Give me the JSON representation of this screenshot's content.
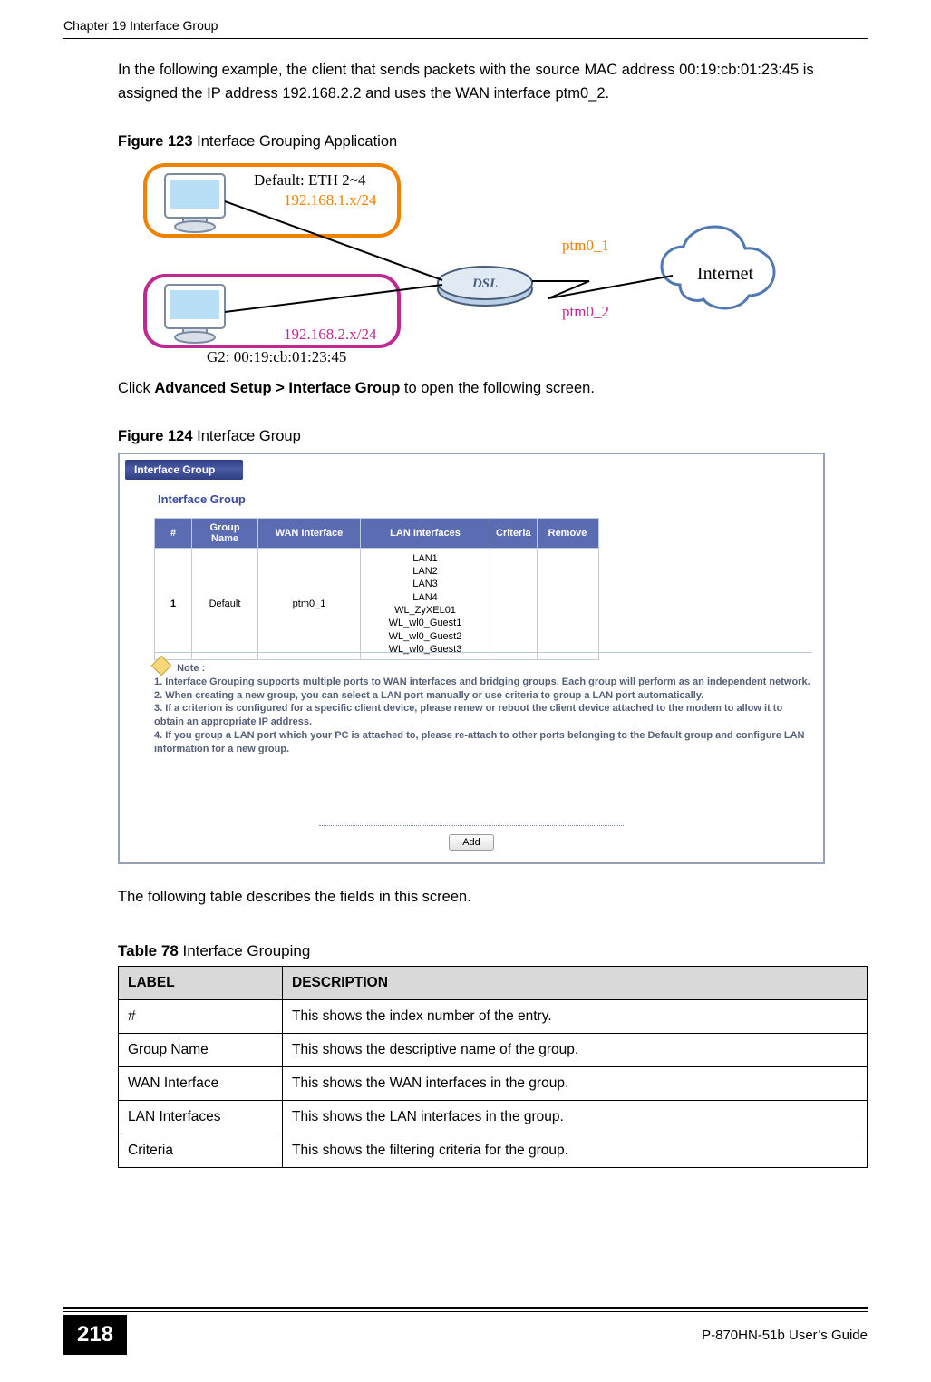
{
  "header": {
    "chapter_title": "Chapter 19 Interface Group"
  },
  "content": {
    "intro_para": "In the following example, the client that sends packets with the source MAC address 00:19:cb:01:23:45 is assigned the IP address 192.168.2.2 and uses the WAN interface ptm0_2.",
    "figure123_num": "Figure 123",
    "figure123_title": "   Interface Grouping Application",
    "diagram": {
      "default_label": "Default: ETH 2~4",
      "default_subnet": "192.168.1.x/24",
      "g2_subnet": "192.168.2.x/24",
      "g2_label": "G2: 00:19:cb:01:23:45",
      "ptm1": "ptm0_1",
      "ptm2": "ptm0_2",
      "internet": "Internet"
    },
    "click_para_prefix": "Click ",
    "click_para_bold": "Advanced Setup > Interface Group",
    "click_para_suffix": " to open the following screen.",
    "figure124_num": "Figure 124",
    "figure124_title": "   Interface Group",
    "screenshot": {
      "bar_title": "Interface Group",
      "section_title": "Interface Group",
      "headers": {
        "num": "#",
        "group": "Group Name",
        "wan": "WAN Interface",
        "lan": "LAN Interfaces",
        "criteria": "Criteria",
        "remove": "Remove"
      },
      "row": {
        "num": "1",
        "group": "Default",
        "wan": "ptm0_1",
        "lan": [
          "LAN1",
          "LAN2",
          "LAN3",
          "LAN4",
          "WL_ZyXEL01",
          "WL_wl0_Guest1",
          "WL_wl0_Guest2",
          "WL_wl0_Guest3"
        ],
        "criteria": "",
        "remove": ""
      },
      "note_label": "Note :",
      "note1": "1. Interface Grouping supports multiple ports to WAN interfaces and bridging groups. Each group will perform as an independent network.",
      "note2": "2. When creating a new group, you can select a LAN port manually or use criteria to group a LAN port automatically.",
      "note3": "3. If a criterion is configured for a specific client device, please renew or reboot the client device attached to the modem to allow it to obtain an appropriate IP address.",
      "note4": "4. If you group a LAN port which your PC is attached to, please re-attach to other ports belonging to the Default group and configure LAN information for a new group.",
      "add_btn": "Add"
    },
    "table_intro": "The following table describes the fields in this screen.",
    "table78_num": "Table 78",
    "table78_title": "   Interface Grouping",
    "desc_table": {
      "header_label": "LABEL",
      "header_desc": "DESCRIPTION",
      "rows": [
        {
          "label": "#",
          "desc": "This shows the index number of the entry."
        },
        {
          "label": "Group Name",
          "desc": "This shows the descriptive name of the group."
        },
        {
          "label": "WAN Interface",
          "desc": "This shows the WAN interfaces in the group."
        },
        {
          "label": "LAN Interfaces",
          "desc": "This shows the LAN interfaces in the group."
        },
        {
          "label": "Criteria",
          "desc": "This shows the filtering criteria for the group."
        }
      ]
    }
  },
  "footer": {
    "page_number": "218",
    "guide": "P-870HN-51b User’s Guide"
  },
  "colors": {
    "orange": "#ef8200",
    "magenta": "#c02894"
  }
}
